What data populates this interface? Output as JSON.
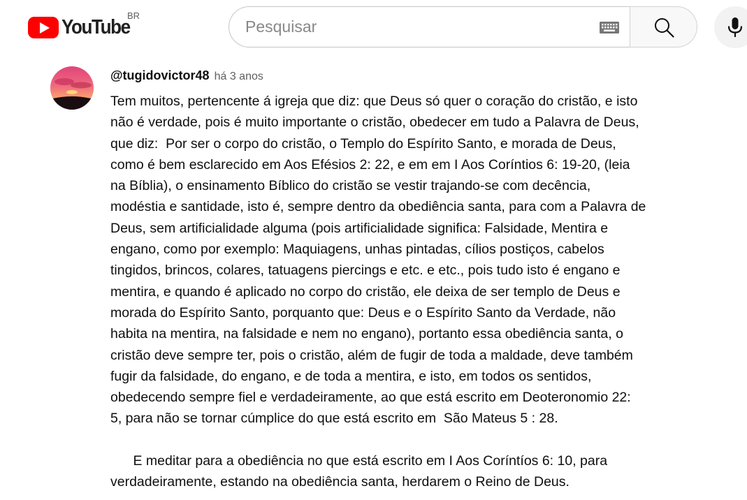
{
  "masthead": {
    "logo_text": "YouTube",
    "country_code": "BR",
    "search_placeholder": "Pesquisar",
    "search_value": "",
    "icons": {
      "logo": "youtube-play-icon",
      "keyboard": "keyboard-icon",
      "search": "search-icon",
      "mic": "mic-icon"
    },
    "brand_color": "#ff0000"
  },
  "comment": {
    "author": "@tugidovictor48",
    "timestamp": "há 3 anos",
    "paragraph_1_lines": [
      "Tem muitos, pertencente á igreja que diz: que Deus só quer o coração do cristão, e isto",
      "não é verdade, pois é muito importante o cristão, obedecer em tudo a Palavra de Deus,",
      "que diz:  Por ser o corpo do cristão, o Templo do Espírito Santo, e morada de Deus,",
      "como é bem esclarecido em Aos Efésios 2: 22, e em em I Aos Coríntios 6: 19-20, (leia",
      "na Bíblia), o ensinamento Bíblico do cristão se vestir trajando-se com decência,",
      "modéstia e santidade, isto é, sempre dentro da obediência santa, para com a Palavra de",
      "Deus, sem artificialidade alguma (pois artificialidade significa: Falsidade, Mentira e",
      "engano, como por exemplo: Maquiagens, unhas pintadas, cílios postiços, cabelos",
      "tingidos, brincos, colares, tatuagens piercings e etc. e etc., pois tudo isto é engano e",
      "mentira, e quando é aplicado no corpo do cristão, ele deixa de ser templo de Deus e",
      "morada do Espírito Santo, porquanto que: Deus e o Espírito Santo da Verdade, não",
      "habita na mentira, na falsidade e nem no engano), portanto essa obediência santa, o",
      "cristão deve sempre ter, pois o cristão, além de fugir de toda a maldade, deve também",
      "fugir da falsidade, do engano, e de toda a mentira, e isto, em todos os sentidos,",
      "obedecendo sempre fiel e verdadeiramente, ao que está escrito em Deoteronomio 22:",
      "5, para não se tornar cúmplice do que está escrito em  São Mateus 5 : 28."
    ],
    "paragraph_2_lines": [
      "      E meditar para a obediência no que está escrito em I Aos Coríntíos 6: 10, para",
      "verdadeiramente, estando na obediência santa, herdarem o Reino de Deus."
    ]
  }
}
